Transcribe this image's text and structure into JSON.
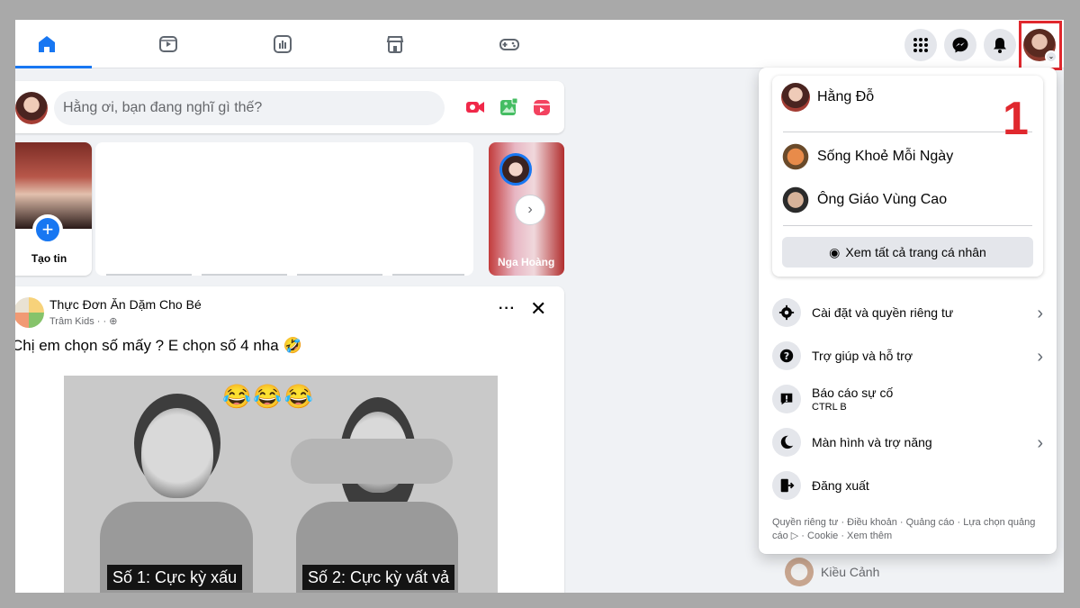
{
  "nav": {
    "tabs": [
      {
        "name": "home-icon",
        "active": true
      },
      {
        "name": "video-icon",
        "active": false
      },
      {
        "name": "feeds-icon",
        "active": false
      },
      {
        "name": "marketplace-icon",
        "active": false
      },
      {
        "name": "gaming-icon",
        "active": false
      }
    ],
    "right_icons": [
      "grid-menu-icon",
      "messenger-icon",
      "bell-icon",
      "profile-avatar"
    ]
  },
  "composer": {
    "placeholder": "Hằng ơi, bạn đang nghĩ gì thế?",
    "actions": [
      "live-video-icon",
      "photo-video-icon",
      "reel-icon"
    ]
  },
  "stories": {
    "create_label": "Tạo tin",
    "items": [
      {
        "label": "Nga Hoàng"
      }
    ],
    "next_icon": "chevron-right-icon"
  },
  "post": {
    "author": "Thực Đơn Ăn Dặm Cho Bé",
    "meta": "Trâm Kids ·            · ⊕",
    "text": "Chị em chọn số mấy ? E chọn số 4 nha 🤣",
    "emojis": "😂😂😂",
    "caption_1": "Số 1: Cực kỳ xấu",
    "caption_2": "Số 2: Cực kỳ vất vả"
  },
  "menu": {
    "current_profile": "Hằng Đỗ",
    "pages": [
      "Sống Khoẻ Mỗi Ngày",
      "Ông Giáo Vùng Cao"
    ],
    "see_all": "Xem tất cả trang cá nhân",
    "items": [
      {
        "label": "Cài đặt và quyền riêng tư",
        "icon": "gear-icon",
        "has_chevron": true
      },
      {
        "label": "Trợ giúp và hỗ trợ",
        "icon": "help-icon",
        "has_chevron": true
      },
      {
        "label": "Báo cáo sự cố",
        "sub": "CTRL B",
        "icon": "report-icon",
        "has_chevron": false
      },
      {
        "label": "Màn hình và trợ năng",
        "icon": "moon-icon",
        "has_chevron": true
      },
      {
        "label": "Đăng xuất",
        "icon": "logout-icon",
        "has_chevron": false
      }
    ],
    "legal": "Quyền riêng tư · Điều khoản · Quảng cáo · Lựa chọn quảng cáo ▷ · Cookie · Xem thêm"
  },
  "annotation": {
    "step_number": "1",
    "highlight_color": "#e0282e"
  },
  "contact_behind": "Kiều Cảnh",
  "colors": {
    "accent": "#1877f2",
    "page_bg": "#f0f2f5"
  }
}
